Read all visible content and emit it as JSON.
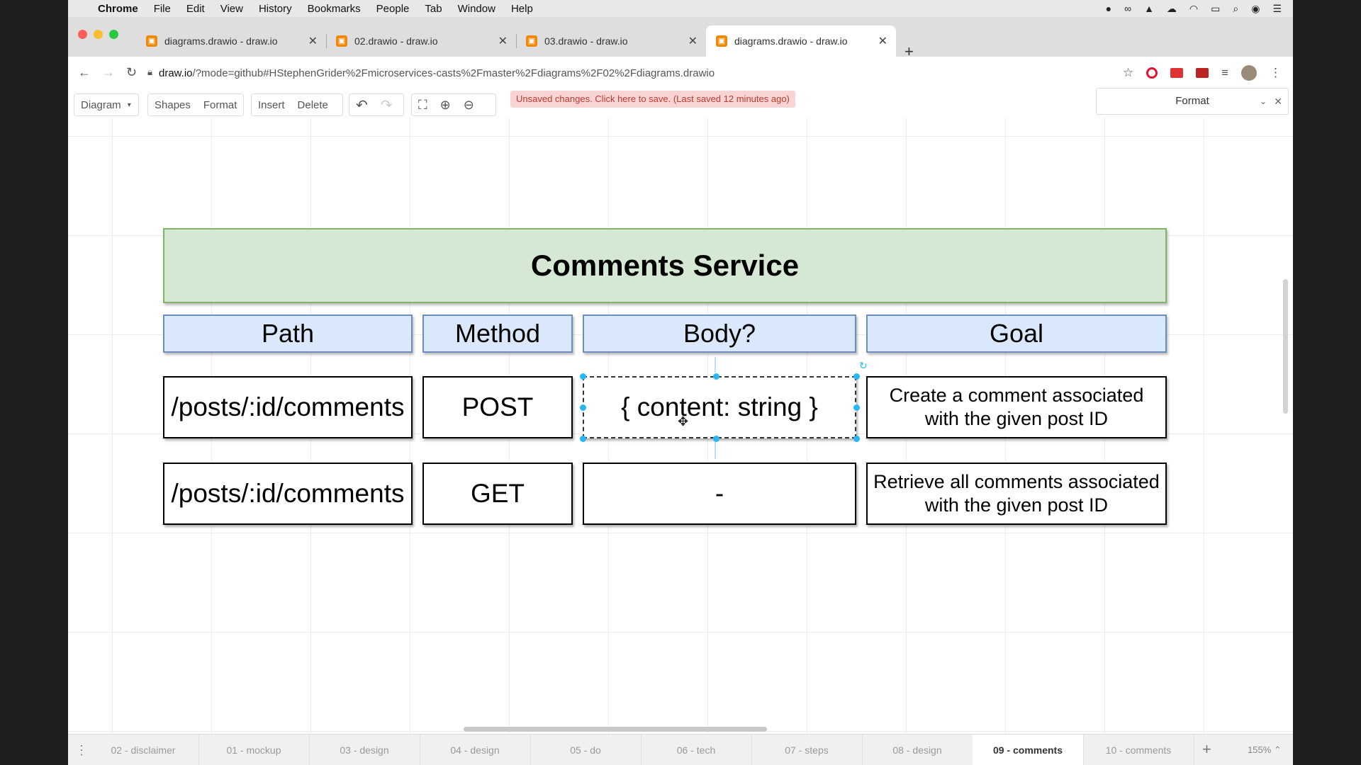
{
  "menubar": {
    "app": "Chrome",
    "items": [
      "File",
      "Edit",
      "View",
      "History",
      "Bookmarks",
      "People",
      "Tab",
      "Window",
      "Help"
    ]
  },
  "tabs": [
    {
      "label": "diagrams.drawio - draw.io"
    },
    {
      "label": "02.drawio - draw.io"
    },
    {
      "label": "03.drawio - draw.io"
    },
    {
      "label": "diagrams.drawio - draw.io"
    }
  ],
  "address": {
    "host": "draw.io",
    "path": "/?mode=github#HStephenGrider%2Fmicroservices-casts%2Fmaster%2Fdiagrams%2F02%2Fdiagrams.drawio"
  },
  "toolbar": {
    "diagram": "Diagram",
    "shapes": "Shapes",
    "format": "Format",
    "insert": "Insert",
    "delete": "Delete",
    "unsaved": "Unsaved changes. Click here to save. (Last saved 12 minutes ago)",
    "format_panel": "Format"
  },
  "diagram": {
    "title": "Comments Service",
    "headers": [
      "Path",
      "Method",
      "Body?",
      "Goal"
    ],
    "rows": [
      {
        "path": "/posts/:id/comments",
        "method": "POST",
        "body": "{ content: string }",
        "goal": "Create a comment associated with the given post ID"
      },
      {
        "path": "/posts/:id/comments",
        "method": "GET",
        "body": "-",
        "goal": "Retrieve all comments associated with the given post ID"
      }
    ]
  },
  "pages": [
    "02 - disclaimer",
    "01 - mockup",
    "03 - design",
    "04 - design",
    "05 - do",
    "06 - tech",
    "07 - steps",
    "08 - design",
    "09 - comments",
    "10 - comments"
  ],
  "active_page": "09 - comments",
  "zoom": "155%"
}
